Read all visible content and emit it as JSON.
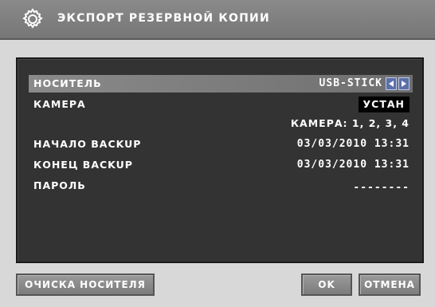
{
  "window": {
    "title": "ЭКСПОРТ РЕЗЕРВНОЙ КОПИИ",
    "icon": "gear-icon"
  },
  "settings": [
    {
      "label": "НОСИТЕЛЬ",
      "value": "USB-STICK",
      "selected": true
    },
    {
      "label": "КАМЕРА",
      "value": "УСТАН"
    },
    {
      "label": "",
      "value": "КАМЕРА: 1, 2, 3, 4"
    },
    {
      "label": "НАЧАЛО BACKUP",
      "value": "03/03/2010 13:31"
    },
    {
      "label": "КОНЕЦ BACKUP",
      "value": "03/03/2010 13:31"
    },
    {
      "label": "ПАРОЛЬ",
      "value": "--------"
    }
  ],
  "buttons": {
    "clear_media": "ОЧИСКА НОСИТЕЛЯ",
    "ok": "OK",
    "cancel": "ОТМЕНА"
  },
  "colors": {
    "panel": "#333333",
    "selection": "#7a7a7a",
    "arrow_button": "#5b6fa8"
  }
}
